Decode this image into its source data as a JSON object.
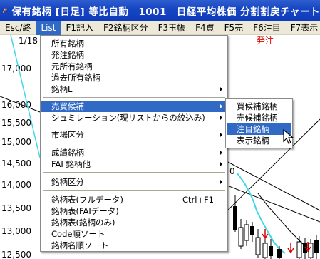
{
  "window": {
    "title": "保有銘柄 [日足] 等比自動　1001　日経平均株価 分割割戻チャート"
  },
  "menubar": {
    "items": [
      {
        "label": "Esc/終",
        "active": false
      },
      {
        "label": "List",
        "active": true
      },
      {
        "label": "F1記入",
        "active": false
      },
      {
        "label": "F2銘柄区分",
        "active": false
      },
      {
        "label": "F3玉帳",
        "active": false
      },
      {
        "label": "F4買",
        "active": false
      },
      {
        "label": "F5売",
        "active": false
      },
      {
        "label": "F6注目",
        "active": false
      },
      {
        "label": "F7表示",
        "active": false
      }
    ]
  },
  "chart": {
    "date_label": "1/18",
    "header_right": "発注",
    "y_tick_labels": [
      "17,000",
      "16,000",
      "15,500",
      "15,000",
      "14,500",
      "14,000",
      "13,500",
      "13,000",
      "12,500"
    ],
    "colors": {
      "ma_line": "#40d8e6",
      "candle_up": "#ffffff",
      "candle_down": "#000000",
      "marker": "#e00000",
      "header_right": "#e00000"
    }
  },
  "list_menu": {
    "items": [
      {
        "label": "所有銘柄",
        "submenu": false
      },
      {
        "label": "発注銘柄",
        "submenu": false
      },
      {
        "label": "元所有銘柄",
        "submenu": false
      },
      {
        "label": "過去所有銘柄",
        "submenu": false
      },
      {
        "label": "銘柄L",
        "submenu": true
      },
      {
        "label": "売買候補",
        "submenu": true,
        "highlighted": true
      },
      {
        "label": "シュミレーション(現リストからの絞込み)",
        "submenu": true
      },
      {
        "label": "市場区分",
        "submenu": true
      },
      {
        "label": "成績銘柄",
        "submenu": true
      },
      {
        "label": "FAI 銘柄他",
        "submenu": true
      },
      {
        "label": "銘柄区分",
        "submenu": true
      },
      {
        "label": "銘柄表(フルデータ)",
        "submenu": false,
        "shortcut": "Ctrl+F1"
      },
      {
        "label": "銘柄表(FAIデータ)",
        "submenu": false
      },
      {
        "label": "銘柄表(銘柄のみ)",
        "submenu": false
      },
      {
        "label": "Code順ソート",
        "submenu": false
      },
      {
        "label": "銘柄名順ソート",
        "submenu": false
      }
    ]
  },
  "sub_menu": {
    "items": [
      {
        "label": "買候補銘柄"
      },
      {
        "label": "売候補銘柄"
      },
      {
        "label": "注目銘柄",
        "highlighted": true
      },
      {
        "label": "表示銘柄"
      }
    ]
  }
}
